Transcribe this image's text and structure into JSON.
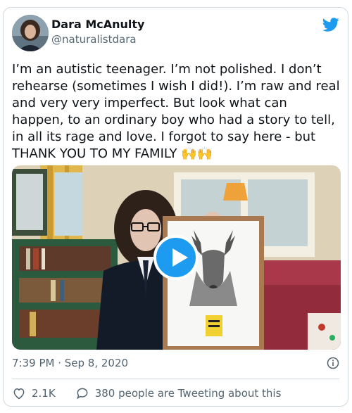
{
  "author": {
    "name": "Dara McAnulty",
    "handle": "@naturalistdara"
  },
  "tweet": {
    "text": "I’m an autistic teenager. I’m not polished. I don’t rehearse (sometimes I wish I did!). I’m raw and real and very very imperfect. But look what can happen, to an ordinary boy who had a story to tell, in all its rage and love. I forgot to say here - but THANK YOU TO MY FAMILY",
    "emoji": "🙌🙌"
  },
  "media": {
    "type": "video"
  },
  "meta": {
    "timestamp": "7:39 PM · Sep 8, 2020"
  },
  "actions": {
    "likes": "2.1K",
    "replies_label": "380 people are Tweeting about this"
  },
  "colors": {
    "accent": "#1d9bf0",
    "text": "#0f1419",
    "muted": "#536471",
    "border": "#cfd9de"
  }
}
